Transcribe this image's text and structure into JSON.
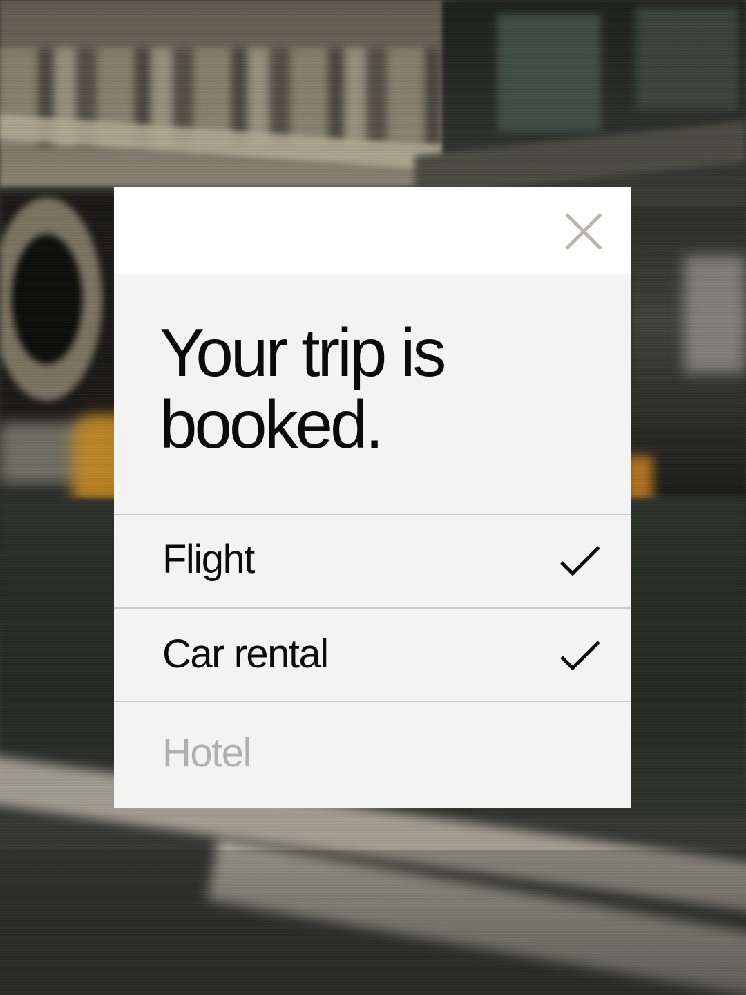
{
  "modal": {
    "title": "Your trip is booked.",
    "items": [
      {
        "label": "Flight",
        "status": "confirmed",
        "icon": "check-icon"
      },
      {
        "label": "Car rental",
        "status": "confirmed",
        "icon": "check-icon"
      },
      {
        "label": "Hotel",
        "status": "pending",
        "icon": null
      }
    ],
    "close_icon": "close-icon"
  },
  "colors": {
    "card_background": "#f3f3f3",
    "card_header": "#ffffff",
    "text_primary": "#0b0b0b",
    "text_muted": "#b0b0b0",
    "close_icon": "#b8b6a8",
    "divider": "#c9c9c9"
  }
}
